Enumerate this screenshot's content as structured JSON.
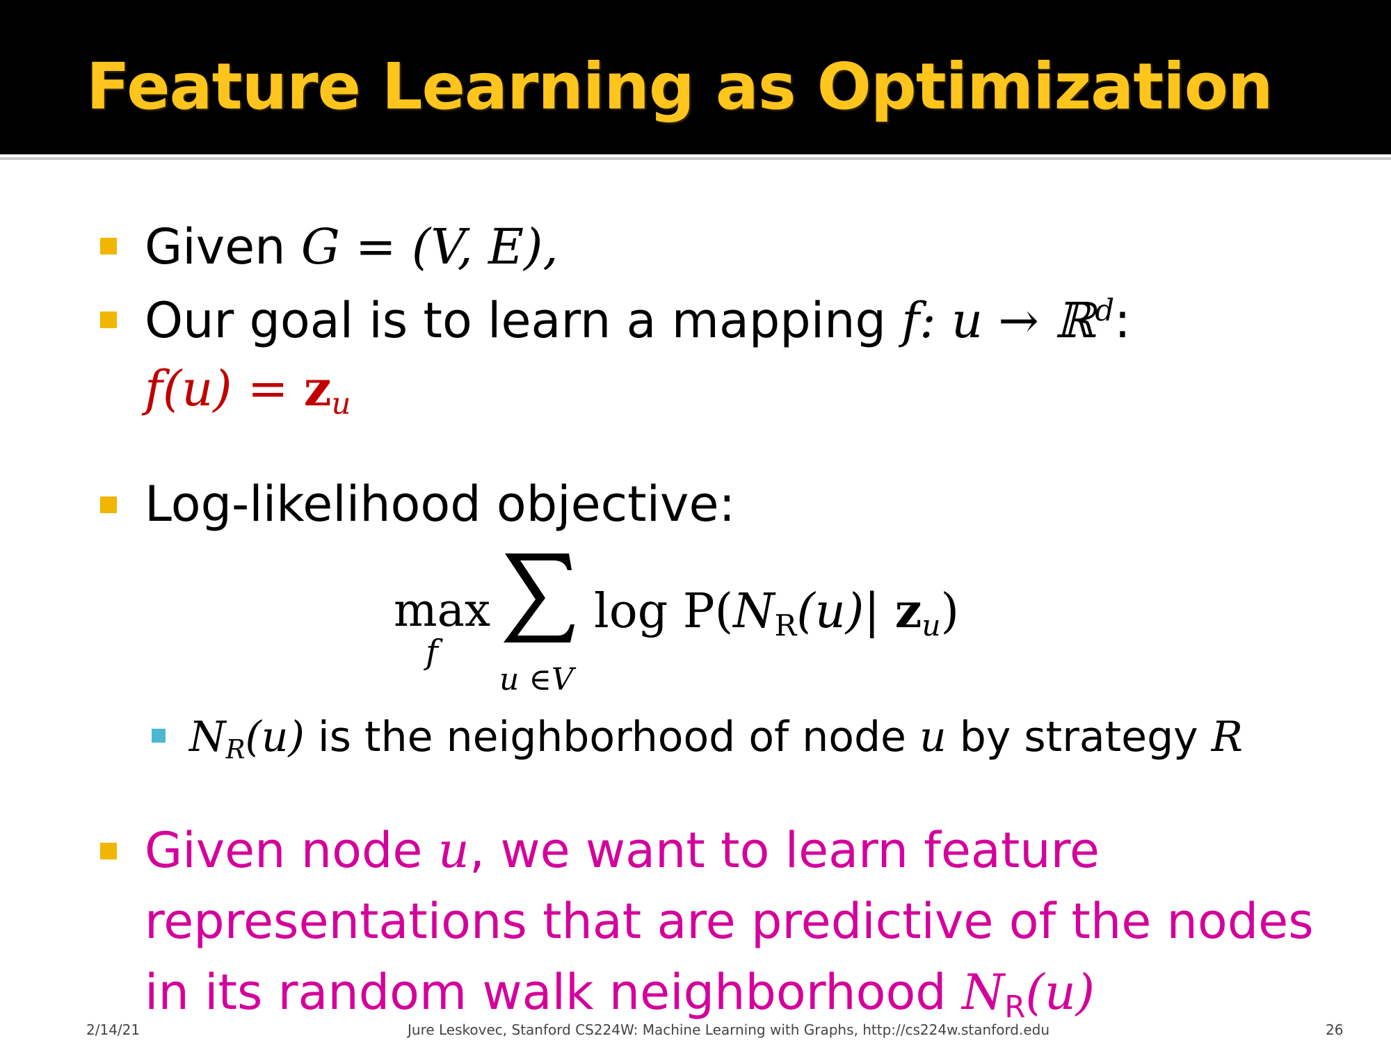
{
  "slide": {
    "title": "Feature Learning as Optimization",
    "title_color": "#ffc51d",
    "titlebar_color": "#000000"
  },
  "bullets": [
    {
      "text_before": "Given ",
      "math": "G = (V, E),"
    },
    {
      "text_before": "Our goal is to learn a mapping ",
      "math": "f: u → ℝ",
      "sup": "d",
      "text_after": ":"
    },
    {
      "formula_main": "f(u) = ",
      "formula_bold": "z",
      "formula_sub": "u"
    },
    {
      "text": "Log-likelihood objective:"
    }
  ],
  "objective": {
    "max": "max",
    "max_sub": "f",
    "sum_sub": "u ∈V",
    "body_before": "log P(",
    "body_N": "N",
    "body_N_sub": "R",
    "body_mid": "(u)| ",
    "body_bold": "z",
    "body_bold_sub": "u",
    "body_after": ")"
  },
  "sub_bullet": {
    "N": "N",
    "N_sub": "R",
    "paren": "(u)",
    "text": " is the neighborhood of node ",
    "node": "u",
    "text2": " by strategy ",
    "strategy": "R"
  },
  "highlight_bullet": {
    "line1_before": "Given node ",
    "line1_math": "u",
    "line1_after": ", we want to learn feature",
    "line2": "representations that are predictive of the nodes",
    "line3_before": "in its random walk neighborhood ",
    "line3_N": "N",
    "line3_N_sub": "R",
    "line3_after": "(u)",
    "color": "#d4009b"
  },
  "footer": {
    "date": "2/14/21",
    "credit": "Jure Leskovec, Stanford CS224W: Machine Learning with Graphs, http://cs224w.stanford.edu",
    "page": "26"
  },
  "colors": {
    "bullet": "#f2b500",
    "sub_bullet": "#4cb8d0",
    "formula_red": "#c00000"
  }
}
